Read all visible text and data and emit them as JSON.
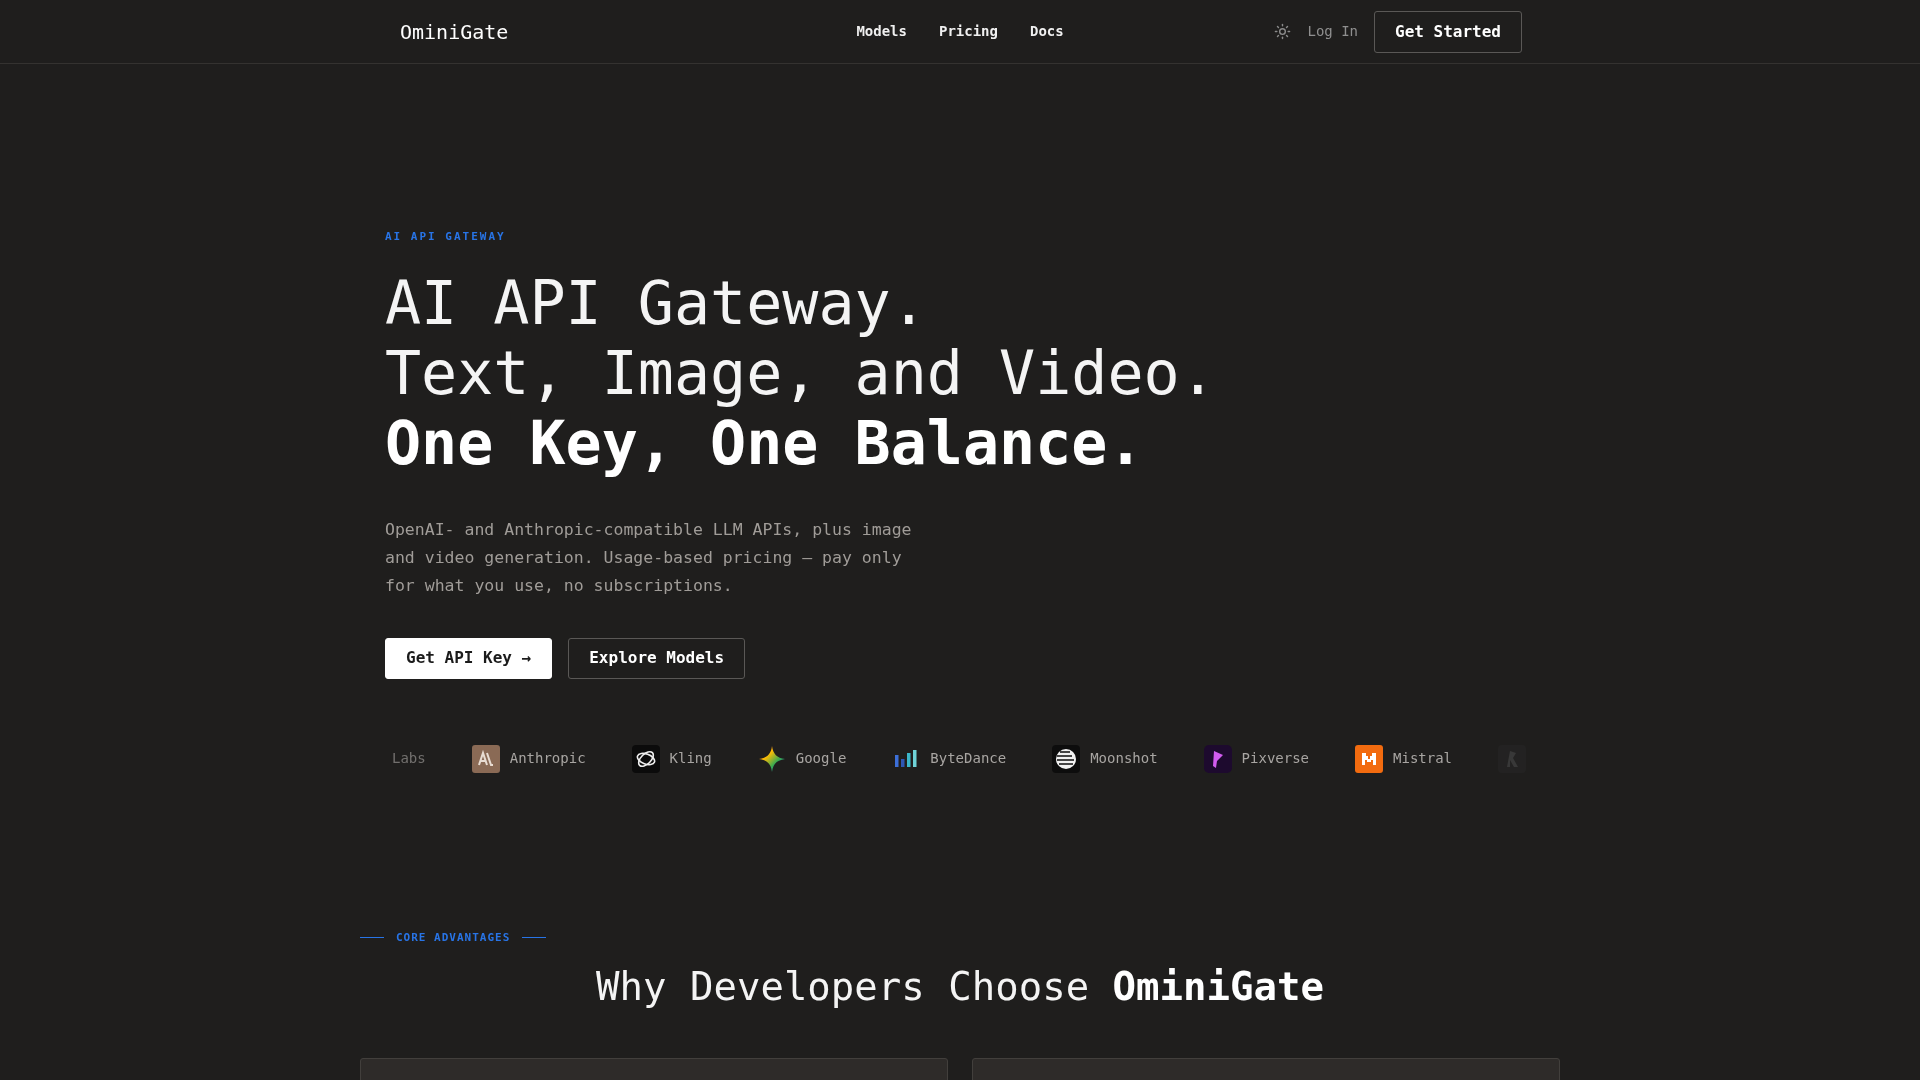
{
  "nav": {
    "brand": "OminiGate",
    "links": [
      {
        "label": "Models"
      },
      {
        "label": "Pricing"
      },
      {
        "label": "Docs"
      }
    ],
    "login": "Log In",
    "cta": "Get Started"
  },
  "hero": {
    "eyebrow": "AI API GATEWAY",
    "heading_lines": [
      {
        "text": "AI API Gateway.",
        "bold": false
      },
      {
        "text": "Text, Image, and Video.",
        "bold": false
      },
      {
        "text": "One Key, One Balance.",
        "bold": true
      }
    ],
    "description": "OpenAI- and Anthropic-compatible LLM APIs, plus image and video generation. Usage-based pricing — pay only for what you use, no subscriptions.",
    "buttons": [
      {
        "label": "Get API Key →",
        "kind": "primary"
      },
      {
        "label": "Explore Models",
        "kind": "secondary"
      }
    ]
  },
  "providers": [
    {
      "name": "Labs",
      "faded": true
    },
    {
      "name": "Anthropic",
      "faded": false
    },
    {
      "name": "Kling",
      "faded": false
    },
    {
      "name": "Google",
      "faded": false
    },
    {
      "name": "ByteDance",
      "faded": false
    },
    {
      "name": "Moonshot",
      "faded": false
    },
    {
      "name": "Pixverse",
      "faded": false
    },
    {
      "name": "Mistral",
      "faded": false
    },
    {
      "faded": true
    }
  ],
  "advantages": {
    "eyebrow": "CORE ADVANTAGES",
    "title": "Why Developers Choose **OminiGate**"
  }
}
